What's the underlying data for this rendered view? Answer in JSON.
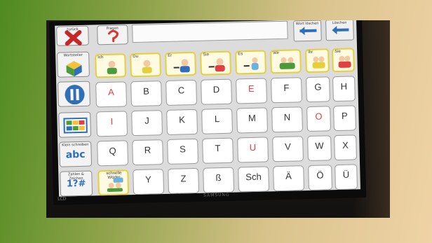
{
  "top": {
    "back_label": "zurück",
    "ask_label": "Fragen",
    "nav_prev_label": "Wort löschen",
    "nav_del_label": "Löschen"
  },
  "side": {
    "wordbox_label": "Wortsteller",
    "small_label": "Klein schreiben",
    "small_text": "abc",
    "numbers_label": "Zahlen & Zeichen",
    "numbers_text": "1?#",
    "quick_label": "schnelle Wörter"
  },
  "pronouns": [
    "Ich",
    "Du",
    "Er",
    "Sie",
    "Es",
    "Wir",
    "Ihr",
    "Sie"
  ],
  "keys": {
    "row1": [
      "A",
      "B",
      "C",
      "D",
      "E",
      "F",
      "G",
      "H"
    ],
    "row2": [
      "I",
      "J",
      "K",
      "L",
      "M",
      "N",
      "O",
      "P"
    ],
    "row3": [
      "Q",
      "R",
      "S",
      "T",
      "U",
      "V",
      "W",
      "X"
    ],
    "row4": [
      "Y",
      "Z",
      "ß",
      "Sch",
      "Ä",
      "Ö",
      "Ü"
    ]
  },
  "monitor": {
    "brand": "SAMSUNG",
    "lcd": "LCD"
  },
  "colors": {
    "vowel": "#e04040",
    "pronoun_border": "#e6cf3c",
    "accent_blue": "#2f6fb7"
  }
}
